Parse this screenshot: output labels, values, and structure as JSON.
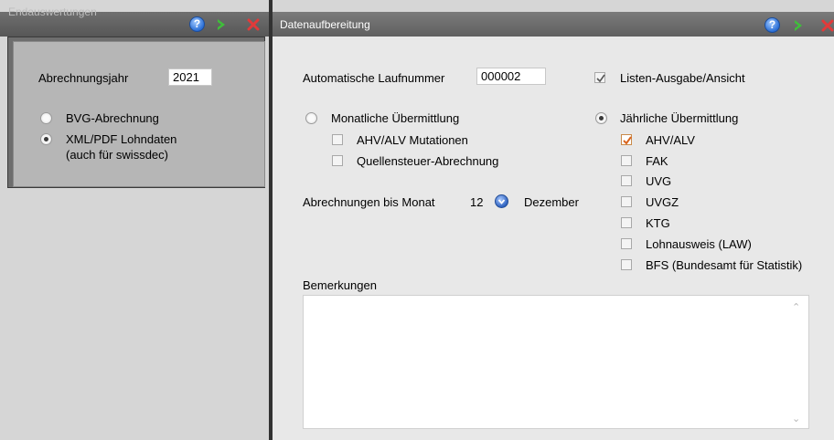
{
  "left": {
    "title": "Endauswertungen",
    "year_label": "Abrechnungsjahr",
    "year_value": "2021",
    "options": [
      {
        "label": "BVG-Abrechnung",
        "selected": false
      },
      {
        "label": "XML/PDF Lohndaten",
        "sub": "(auch für swissdec)",
        "selected": true
      }
    ]
  },
  "right": {
    "title": "Datenaufbereitung",
    "laufnummer_label": "Automatische Laufnummer",
    "laufnummer_value": "000002",
    "listen_label": "Listen-Ausgabe/Ansicht",
    "listen_checked": true,
    "monthly": {
      "label": "Monatliche Übermittlung",
      "selected": false,
      "items": [
        {
          "label": "AHV/ALV Mutationen",
          "checked": false
        },
        {
          "label": "Quellensteuer-Abrechnung",
          "checked": false
        }
      ]
    },
    "yearly": {
      "label": "Jährliche Übermittlung",
      "selected": true,
      "items": [
        {
          "label": "AHV/ALV",
          "checked": true
        },
        {
          "label": "FAK",
          "checked": false
        },
        {
          "label": "UVG",
          "checked": false
        },
        {
          "label": "UVGZ",
          "checked": false
        },
        {
          "label": "KTG",
          "checked": false
        },
        {
          "label": "Lohnausweis (LAW)",
          "checked": false
        },
        {
          "label": "BFS (Bundesamt für Statistik)",
          "checked": false
        }
      ]
    },
    "month_label": "Abrechnungen bis Monat",
    "month_value": "12",
    "month_name": "Dezember",
    "notes_label": "Bemerkungen"
  },
  "colors": {
    "help": "#2b6fd6",
    "arrow": "#3fbf3a",
    "close": "#e23a3a",
    "check_accent": "#d9641e"
  },
  "icons": [
    "help-icon",
    "arrow-right-icon",
    "close-icon",
    "spin-icon",
    "checkmark-icon"
  ]
}
